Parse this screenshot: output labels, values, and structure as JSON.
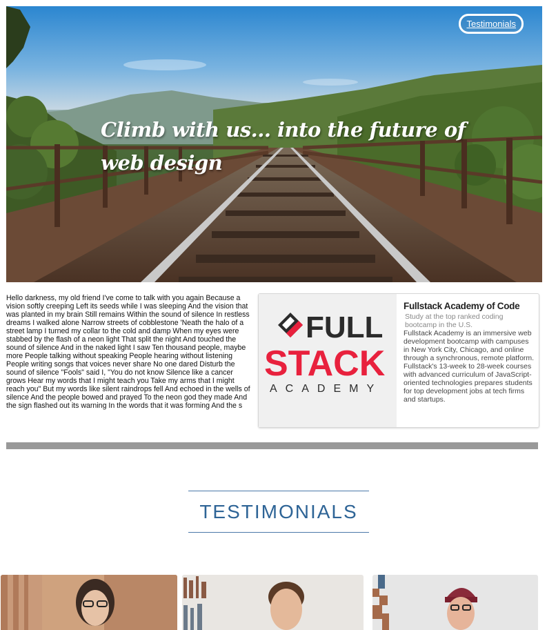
{
  "nav": {
    "testimonials_label": "Testimonials"
  },
  "hero": {
    "title": "Climb with us... into the future of web design"
  },
  "lyric": {
    "text": "Hello darkness, my old friend I've come to talk with you again Because a vision softly creeping Left its seeds while I was sleeping And the vision that was planted in my brain Still remains Within the sound of silence In restless dreams I walked alone Narrow streets of cobblestone 'Neath the halo of a street lamp I turned my collar to the cold and damp When my eyes were stabbed by the flash of a neon light That split the night And touched the sound of silence And in the naked light I saw Ten thousand people, maybe more People talking without speaking People hearing without listening People writing songs that voices never share No one dared Disturb the sound of silence \"Fools\" said I, \"You do not know Silence like a cancer grows Hear my words that I might teach you Take my arms that I might reach you\" But my words like silent raindrops fell And echoed in the wells of silence And the people bowed and prayed To the neon god they made And the sign flashed out its warning In the words that it was forming And the s"
  },
  "card": {
    "logo_text_line1": "FULL",
    "logo_text_line2": "STACK",
    "logo_text_line3": "ACADEMY",
    "title": "Fullstack Academy of Code",
    "subtitle": "Study at the top ranked coding bootcamp in the U.S.",
    "description": "Fullstack Academy is an immersive web development bootcamp with campuses in New York City, Chicago, and online through a synchronous, remote platform. Fullstack's 13-week to 28-week courses with advanced curriculum of JavaScript-oriented technologies prepares students for top development jobs at tech firms and startups."
  },
  "testimonials": {
    "heading": "TESTIMONIALS"
  },
  "colors": {
    "logo_red": "#e8213d",
    "logo_dark": "#2b2b2b",
    "heading_blue": "#2e6496"
  }
}
